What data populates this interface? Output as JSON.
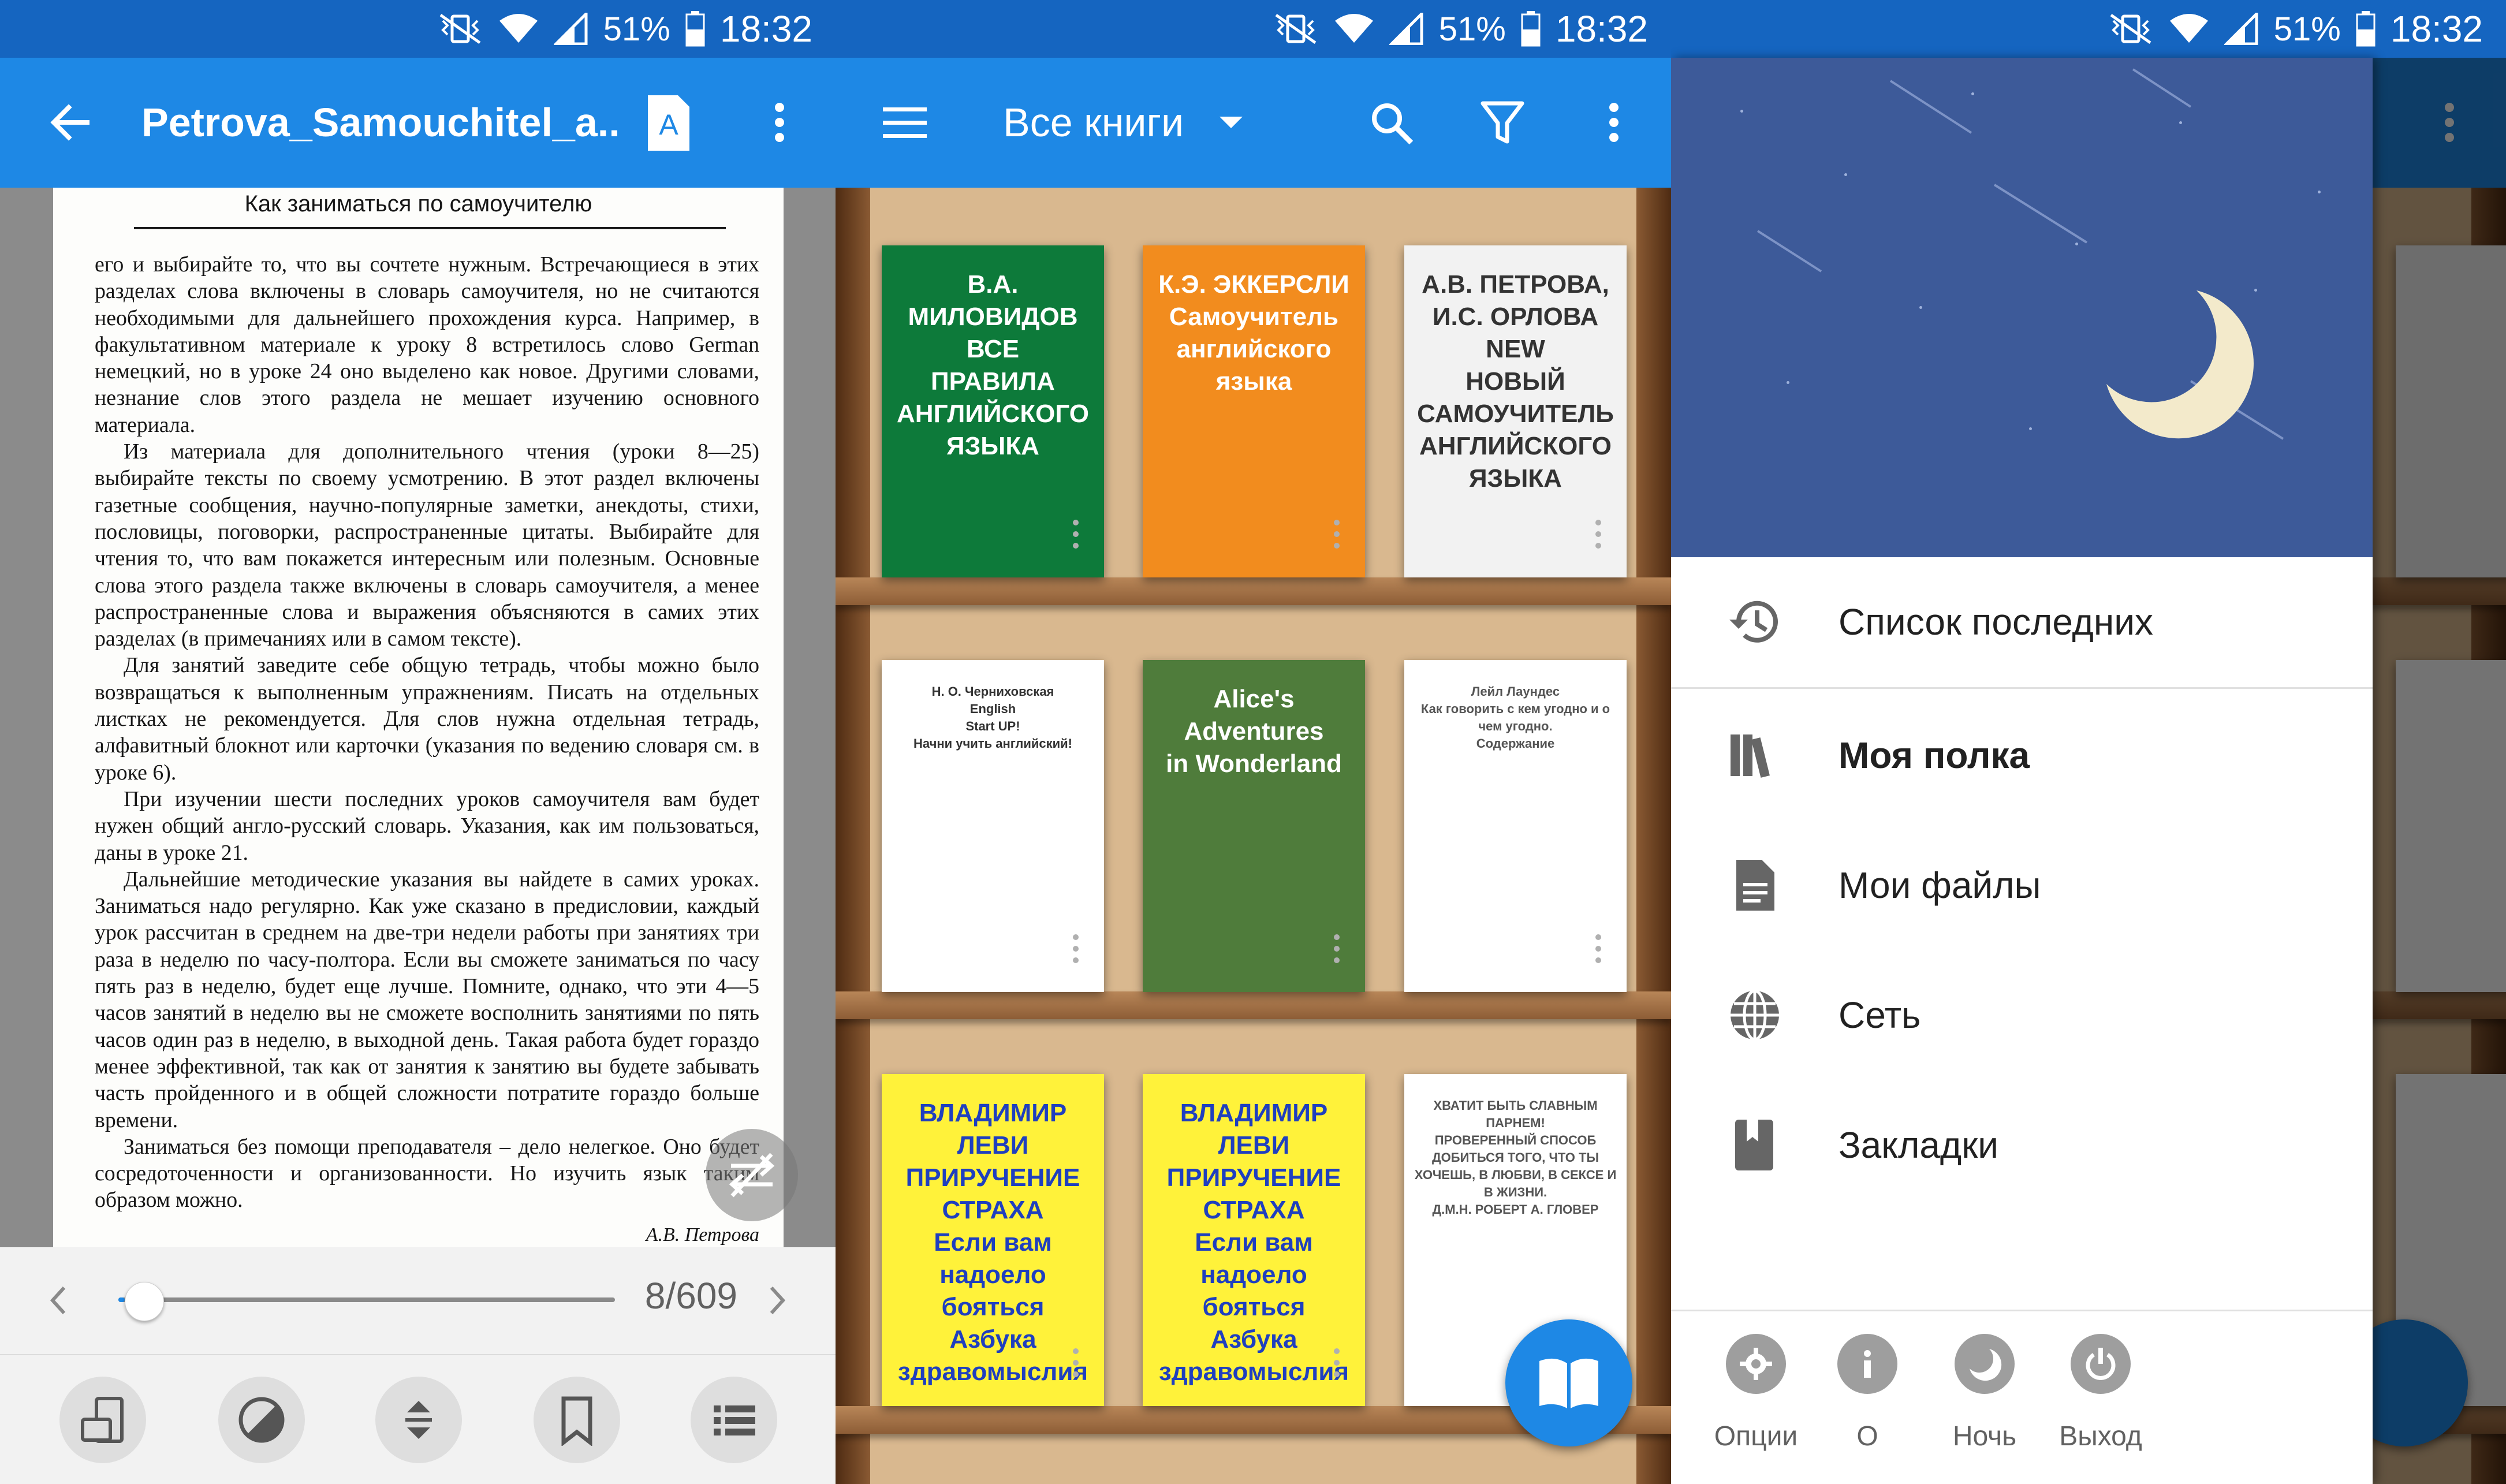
{
  "status_bar": {
    "battery": "51%",
    "time": "18:32"
  },
  "reader": {
    "title": "Petrova_Samouchitel_a..",
    "running_head": "Как заниматься по самоучителю",
    "paragraphs": [
      "его и выбирайте то, что вы сочтете нужным. Встречающиеся в этих разделах слова включены в словарь самоучителя, но не считаются необходимыми для дальнейшего прохождения курса. Например, в факультативном материале к уроку 8 встретилось слово German немецкий, но в уроке 24 оно выделено как новое. Другими словами, незнание слов этого раздела не мешает изучению основного материала.",
      "Из материала для дополнительного чтения (уроки 8—25) выбирайте тексты по своему усмотрению. В этот раздел включены газетные сообщения, научно-популярные заметки, анекдоты, стихи, пословицы, поговорки, распространенные цитаты. Выбирайте для чтения то, что вам покажется интересным или полезным. Основные слова этого раздела также включены в словарь самоучителя, а менее распространенные слова и выражения объясняются в самих этих разделах (в примечаниях или в самом тексте).",
      "Для занятий заведите себе общую тетрадь, чтобы можно было возвращаться к выполненным упражнениям. Писать на отдельных листках не рекомендуется. Для слов нужна отдельная тетрадь, алфавитный блокнот или карточки (указания по ведению словаря см. в уроке 6).",
      "При изучении шести последних уроков самоучителя вам будет нужен общий англо-русский словарь. Указания, как им пользоваться, даны в уроке 21.",
      "Дальнейшие методические указания вы найдете в самих уроках. Заниматься надо регулярно. Как уже сказано в предисловии, каждый урок рассчитан в среднем на две-три недели работы при занятиях три раза в неделю по часу-полтора. Если вы сможете заниматься по часу пять раз в неделю, будет еще лучше. Помните, однако, что эти 4—5 часов занятий в неделю вы не сможете восполнить занятиями по пять часов один раз в неделю, в выходной день. Такая работа будет гораздо менее эффективной, так как от занятия к занятию вы будете забывать часть пройденного и в общей сложности потратите гораздо больше времени.",
      "Заниматься без помощи преподавателя – дело нелегкое. Оно будет сосредоточенности и организованности. Но изучить язык таким образом можно."
    ],
    "signature": "А.В. Петрова",
    "page_indicator": "8/609",
    "progress": 0.013
  },
  "library": {
    "title": "Все книги",
    "books": [
      {
        "cover_lines": "В.А. МИЛОВИДОВ\nВСЕ\nПРАВИЛА\nАНГЛИЙСКОГО\nЯЗЫКА",
        "bg": "#0d7a3a",
        "fg": "#ffffff"
      },
      {
        "cover_lines": "К.Э. ЭККЕРСЛИ\nСамоучитель\nанглийского\nязыка",
        "bg": "#f28c1e",
        "fg": "#ffffff"
      },
      {
        "cover_lines": "А.В. ПЕТРОВА, И.С. ОРЛОВА\nNEW\nНОВЫЙ\nСАМОУЧИТЕЛЬ\nАНГЛИЙСКОГО\nЯЗЫКА",
        "bg": "#f2f2f2",
        "fg": "#333333"
      },
      {
        "cover_lines": "Н. О. Черниховская\nEnglish\nStart UP!\nНачни учить английский!",
        "bg": "#ffffff",
        "fg": "#333333"
      },
      {
        "cover_lines": "Alice's\nAdventures\nin Wonderland",
        "bg": "#4f7c3b",
        "fg": "#ffffff"
      },
      {
        "cover_lines": "Лейл Лаундес\nКак говорить с кем угодно и о чем угодно.\nСодержание",
        "bg": "#ffffff",
        "fg": "#555555"
      },
      {
        "cover_lines": "ВЛАДИМИР\nЛЕВИ\nПРИРУЧЕНИЕ\nСТРАХА\nЕсли вам надоело бояться\nАзбука здравомыслия",
        "bg": "#fff23a",
        "fg": "#1f3fbf"
      },
      {
        "cover_lines": "ВЛАДИМИР\nЛЕВИ\nПРИРУЧЕНИЕ\nСТРАХА\nЕсли вам надоело бояться\nАзбука здравомыслия",
        "bg": "#fff23a",
        "fg": "#1f3fbf"
      },
      {
        "cover_lines": "ХВАТИТ БЫТЬ СЛАВНЫМ ПАРНЕМ!\nПРОВЕРЕННЫЙ СПОСОБ ДОБИТЬСЯ ТОГО, ЧТО ТЫ ХОЧЕШЬ, В ЛЮБВИ, В СЕКСЕ И В ЖИЗНИ.\nД.М.Н. РОБЕРТ А. ГЛОВЕР",
        "bg": "#ffffff",
        "fg": "#555555"
      }
    ]
  },
  "drawer": {
    "items": [
      {
        "label": "Список последних",
        "icon": "history-icon",
        "bold": false
      },
      {
        "label": "Моя полка",
        "icon": "bookshelf-icon",
        "bold": true
      },
      {
        "label": "Мои файлы",
        "icon": "file-icon",
        "bold": false
      },
      {
        "label": "Сеть",
        "icon": "globe-icon",
        "bold": false
      },
      {
        "label": "Закладки",
        "icon": "bookmark-icon",
        "bold": false
      }
    ],
    "footer": [
      {
        "label": "Опции",
        "icon": "gear-icon"
      },
      {
        "label": "О",
        "icon": "info-icon"
      },
      {
        "label": "Ночь",
        "icon": "moon-icon"
      },
      {
        "label": "Выход",
        "icon": "power-icon"
      }
    ]
  },
  "colors": {
    "status_bar": "#1565c0",
    "app_bar": "#1e88e5",
    "accent": "#1e88e5"
  }
}
